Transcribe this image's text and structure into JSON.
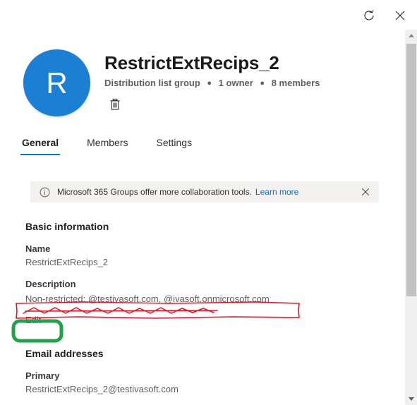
{
  "window": {
    "refresh_label": "Refresh",
    "close_label": "Close"
  },
  "group": {
    "avatar_initial": "R",
    "title": "RestrictExtRecips_2",
    "type": "Distribution list group",
    "owners": "1 owner",
    "members": "8 members",
    "separator": "●",
    "delete_label": "Delete"
  },
  "tabs": [
    {
      "label": "General",
      "active": true
    },
    {
      "label": "Members",
      "active": false
    },
    {
      "label": "Settings",
      "active": false
    }
  ],
  "message_bar": {
    "icon": "info-icon",
    "text": "Microsoft 365 Groups offer more collaboration tools.",
    "link": "Learn more",
    "close_icon": "close-icon"
  },
  "basic_information": {
    "heading": "Basic information",
    "name_label": "Name",
    "name_value": "RestrictExtRecips_2",
    "description_label": "Description",
    "description_value": "Non-restricted: @testivasoft.com, @ivasoft.onmicrosoft.com",
    "edit_label": "Edit"
  },
  "email_addresses": {
    "heading": "Email addresses",
    "primary_label": "Primary",
    "primary_value": "RestrictExtRecips_2@testivasoft.com"
  },
  "scrollbar": {
    "up_arrow": "scroll-up-arrow",
    "down_arrow": "scroll-down-arrow"
  },
  "colors": {
    "accent": "#0078d4",
    "avatar": "#1b7fd4",
    "link": "#0f6cbd",
    "annotation_red": "#e81123",
    "annotation_green": "#21a24a",
    "messagebar_bg": "#f3f2f1"
  }
}
